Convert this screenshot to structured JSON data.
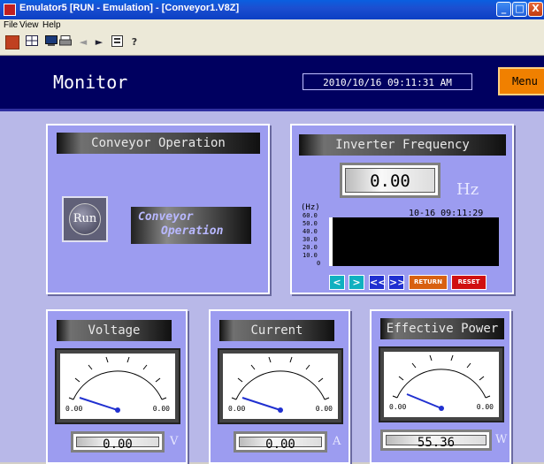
{
  "window": {
    "title": "Emulator5 [RUN - Emulation] - [Conveyor1.V8Z]",
    "buttons": {
      "minimize": "_",
      "maximize": "□",
      "close": "X"
    }
  },
  "menu": {
    "items": [
      "File",
      "View",
      "Help"
    ]
  },
  "toolbar": {
    "icons": [
      "run-icon",
      "grid-icon",
      "screen-icon",
      "print-icon",
      "prev-icon",
      "next-icon",
      "display-icon",
      "help-icon"
    ],
    "help_glyph": "?"
  },
  "header": {
    "title": "Monitor",
    "datetime": "2010/10/16 09:11:31 AM",
    "menu_button": "Menu"
  },
  "conveyor": {
    "label": "Conveyor Operation",
    "run_button": "Run",
    "status_line1": "Conveyor",
    "status_line2": "Operation"
  },
  "inverter": {
    "label": "Inverter Frequency",
    "value": "0.00",
    "unit": "Hz",
    "trend_unit": "(Hz)",
    "trend_timestamp": "10-16 09:11:29",
    "y_ticks": [
      "60.0",
      "50.0",
      "40.0",
      "30.0",
      "20.0",
      "10.0",
      "0"
    ],
    "nav": {
      "prev": "<",
      "next": ">",
      "first": "<<",
      "last": ">>",
      "return": "RETURN",
      "reset": "RESET"
    }
  },
  "voltage": {
    "label": "Voltage",
    "min": "0.00",
    "max": "0.00",
    "value": "0.00",
    "unit": "V"
  },
  "current": {
    "label": "Current",
    "min": "0.00",
    "max": "0.00",
    "value": "0.00",
    "unit": "A"
  },
  "power": {
    "label": "Effective Power",
    "min": "0.00",
    "max": "0.00",
    "value": "55.36",
    "unit": "W"
  },
  "colors": {
    "header": "#000060",
    "panel": "#9c9cf0",
    "menu_button": "#f08000",
    "reset": "#d01010",
    "return": "#d86010",
    "nav": "#10b0c0",
    "nav_dark": "#2030d0"
  }
}
